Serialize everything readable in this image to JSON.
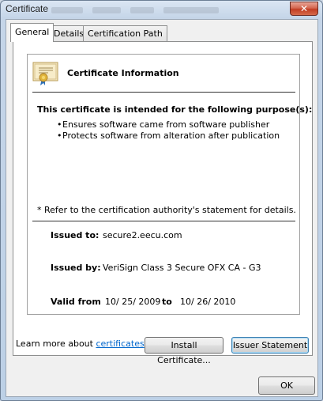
{
  "window": {
    "title": "Certificate",
    "close_glyph": "✕"
  },
  "tabs": [
    {
      "label": "General",
      "active": true
    },
    {
      "label": "Details",
      "active": false
    },
    {
      "label": "Certification Path",
      "active": false
    }
  ],
  "cert": {
    "icon": "certificate-icon",
    "heading": "Certificate Information",
    "purpose_heading": "This certificate is intended for the following purpose(s):",
    "purposes": [
      "Ensures software came from software publisher",
      "Protects software from alteration after publication"
    ],
    "bullet_glyph": "•",
    "refer_note": "* Refer to the certification authority's statement for details.",
    "issued_to_label": "Issued to:",
    "issued_to_value": "secure2.eecu.com",
    "issued_by_label": "Issued by:",
    "issued_by_value": "VeriSign Class 3 Secure OFX CA - G3",
    "valid_from_label": "Valid from",
    "valid_from_value": "10/ 25/ 2009",
    "valid_to_label": "to",
    "valid_to_value": "10/ 26/ 2010"
  },
  "buttons": {
    "install_label": "Install Certificate...",
    "issuer_statement_label": "Issuer Statement",
    "ok_label": "OK"
  },
  "learn_more": {
    "prefix": "Learn more about",
    "link": "certificates"
  }
}
